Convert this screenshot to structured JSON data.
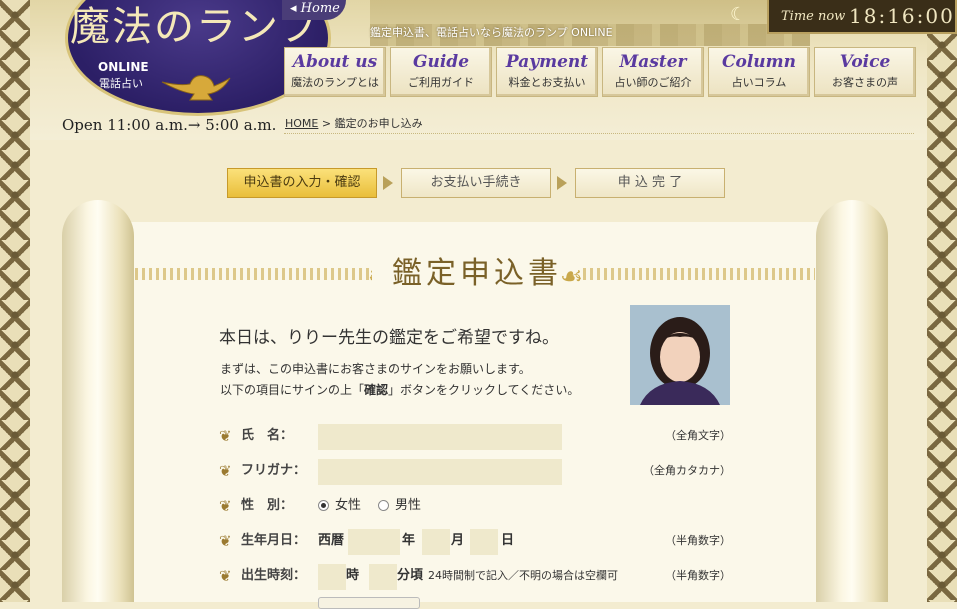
{
  "header": {
    "logo_title": "魔法のランプ",
    "logo_sub1": "ONLINE",
    "logo_sub2": "電話占い",
    "home_label": "◂ Home",
    "tagline": "鑑定申込書、電話占いなら魔法のランプ ONLINE",
    "open_hours": "Open 11:00 a.m.→ 5:00 a.m.",
    "clock": {
      "label": "Time now",
      "value": "18:16:00"
    }
  },
  "nav": [
    {
      "en": "About us",
      "ja": "魔法のランプとは"
    },
    {
      "en": "Guide",
      "ja": "ご利用ガイド"
    },
    {
      "en": "Payment",
      "ja": "料金とお支払い"
    },
    {
      "en": "Master",
      "ja": "占い師のご紹介"
    },
    {
      "en": "Column",
      "ja": "占いコラム"
    },
    {
      "en": "Voice",
      "ja": "お客さまの声"
    }
  ],
  "breadcrumb": {
    "home": "HOME",
    "sep": ">",
    "current": "鑑定のお申し込み"
  },
  "steps": [
    {
      "label": "申込書の入力・確認",
      "active": true
    },
    {
      "label": "お支払い手続き",
      "active": false
    },
    {
      "label": "申 込 完 了",
      "active": false
    }
  ],
  "form": {
    "title": "鑑定申込書",
    "lead": "本日は、りりー先生の鑑定をご希望ですね。",
    "desc1": "まずは、この申込書にお客さまのサインをお願いします。",
    "desc2_pre": "以下の項目にサインの上「",
    "desc2_bold": "確認",
    "desc2_post": "」ボタンをクリックしてください。",
    "fields": {
      "name": {
        "label": "氏　名：",
        "value": "",
        "note": "（全角文字）"
      },
      "kana": {
        "label": "フリガナ：",
        "value": "",
        "note": "（全角カタカナ）"
      },
      "gender": {
        "label": "性　別：",
        "options": [
          "女性",
          "男性"
        ],
        "selected": "女性"
      },
      "birthday": {
        "label": "生年月日：",
        "era": "西暦",
        "year_unit": "年",
        "month_unit": "月",
        "day_unit": "日",
        "note": "（半角数字）"
      },
      "birthtime": {
        "label": "出生時刻：",
        "hour_unit": "時",
        "minute_unit": "分頃",
        "hint": "24時間制で記入／不明の場合は空欄可",
        "note": "（半角数字）"
      }
    }
  },
  "colors": {
    "accent": "#5a3aa0",
    "step_active": "#e9be3a",
    "field_bg": "#efe9cc"
  }
}
